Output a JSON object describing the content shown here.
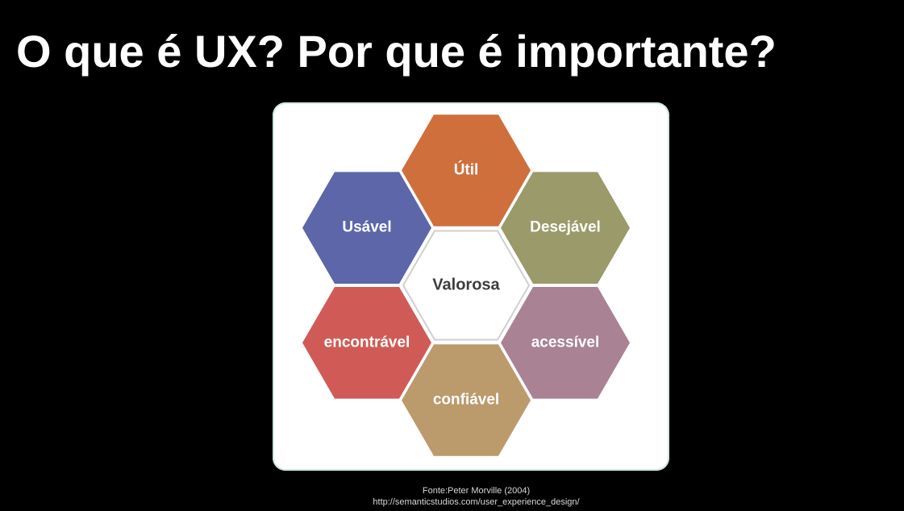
{
  "slide": {
    "title": "O que é UX? Por que é importante?"
  },
  "diagram": {
    "center": {
      "label": "Valorosa",
      "color": "#ffffff"
    },
    "facets": [
      {
        "label": "Útil",
        "color": "#cf6f3c"
      },
      {
        "label": "Desejável",
        "color": "#9a9a6a"
      },
      {
        "label": "acessível",
        "color": "#a98293"
      },
      {
        "label": "confiável",
        "color": "#bb9a6c"
      },
      {
        "label": "encontrável",
        "color": "#d05b56"
      },
      {
        "label": "Usável",
        "color": "#5c66a8"
      }
    ]
  },
  "footer": {
    "source": "Fonte:Peter Morville (2004)",
    "url": "http://semanticstudios.com/user_experience_design/"
  }
}
